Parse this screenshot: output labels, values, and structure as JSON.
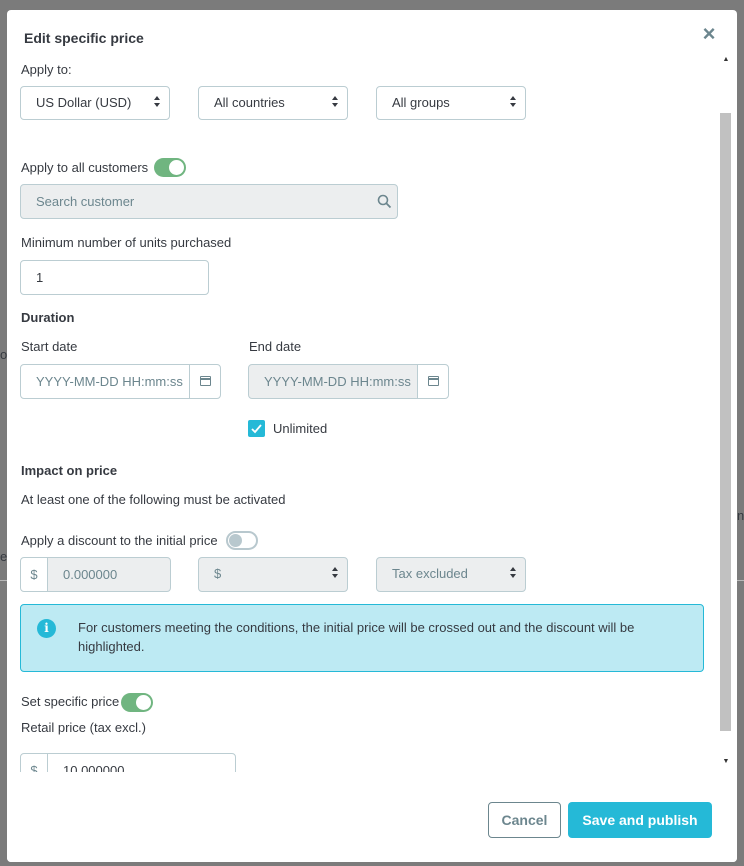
{
  "background": {
    "fragment_left": "o",
    "fragment_left2": "e",
    "fragment_right": "n"
  },
  "modal": {
    "title": "Edit specific price",
    "close_icon": "×"
  },
  "apply_to": {
    "label": "Apply to:",
    "currency": "US Dollar (USD)",
    "country": "All countries",
    "group": "All groups"
  },
  "customers": {
    "apply_all_label": "Apply to all customers",
    "apply_all_enabled": true,
    "search_placeholder": "Search customer"
  },
  "min_units": {
    "label": "Minimum number of units purchased",
    "value": "1"
  },
  "duration": {
    "heading": "Duration",
    "start_label": "Start date",
    "start_placeholder": "YYYY-MM-DD HH:mm:ss",
    "end_label": "End date",
    "end_placeholder": "YYYY-MM-DD HH:mm:ss",
    "unlimited_label": "Unlimited",
    "unlimited_checked": true
  },
  "impact": {
    "heading": "Impact on price",
    "note": "At least one of the following must be activated",
    "discount_label": "Apply a discount to the initial price",
    "discount_enabled": false,
    "discount_currency_symbol": "$",
    "discount_value": "0.000000",
    "discount_type": "$",
    "tax_mode": "Tax excluded",
    "info_text": "For customers meeting the conditions, the initial price will be crossed out and the discount will be highlighted.",
    "specific_price_label": "Set specific price",
    "specific_price_enabled": true,
    "retail_label": "Retail price (tax excl.)",
    "retail_currency_symbol": "$",
    "retail_value": "10.000000"
  },
  "footer": {
    "cancel_label": "Cancel",
    "save_label": "Save and publish"
  },
  "colors": {
    "accent": "#25b9d7",
    "toggle_on": "#70b580",
    "text": "#363a41",
    "muted": "#6c868e"
  }
}
